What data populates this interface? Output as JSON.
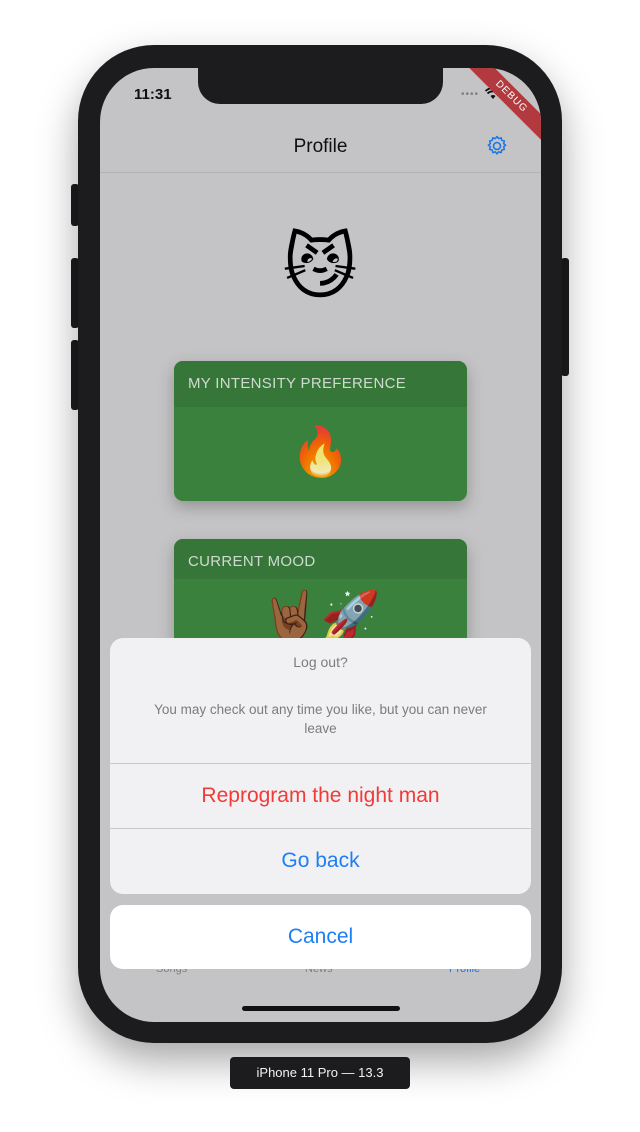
{
  "status": {
    "time": "11:31",
    "debug": "DEBUG"
  },
  "nav": {
    "title": "Profile",
    "settings_icon": "gear-icon"
  },
  "profile": {
    "avatar": "😼"
  },
  "cards": [
    {
      "title": "MY INTENSITY PREFERENCE",
      "emoji": "🔥"
    },
    {
      "title": "CURRENT MOOD",
      "emoji": "🤘🏾🚀"
    }
  ],
  "tabs": [
    {
      "label": "Songs"
    },
    {
      "label": "News"
    },
    {
      "label": "Profile",
      "active": true
    }
  ],
  "action_sheet": {
    "title": "Log out?",
    "message": "You may check out any time you like, but you can never leave",
    "destructive_label": "Reprogram the night man",
    "default_label": "Go back",
    "cancel_label": "Cancel"
  },
  "device_label": "iPhone 11 Pro — 13.3",
  "colors": {
    "accent": "#1e7ef3",
    "destructive": "#f13b38",
    "card_green": "#3f8a42"
  }
}
